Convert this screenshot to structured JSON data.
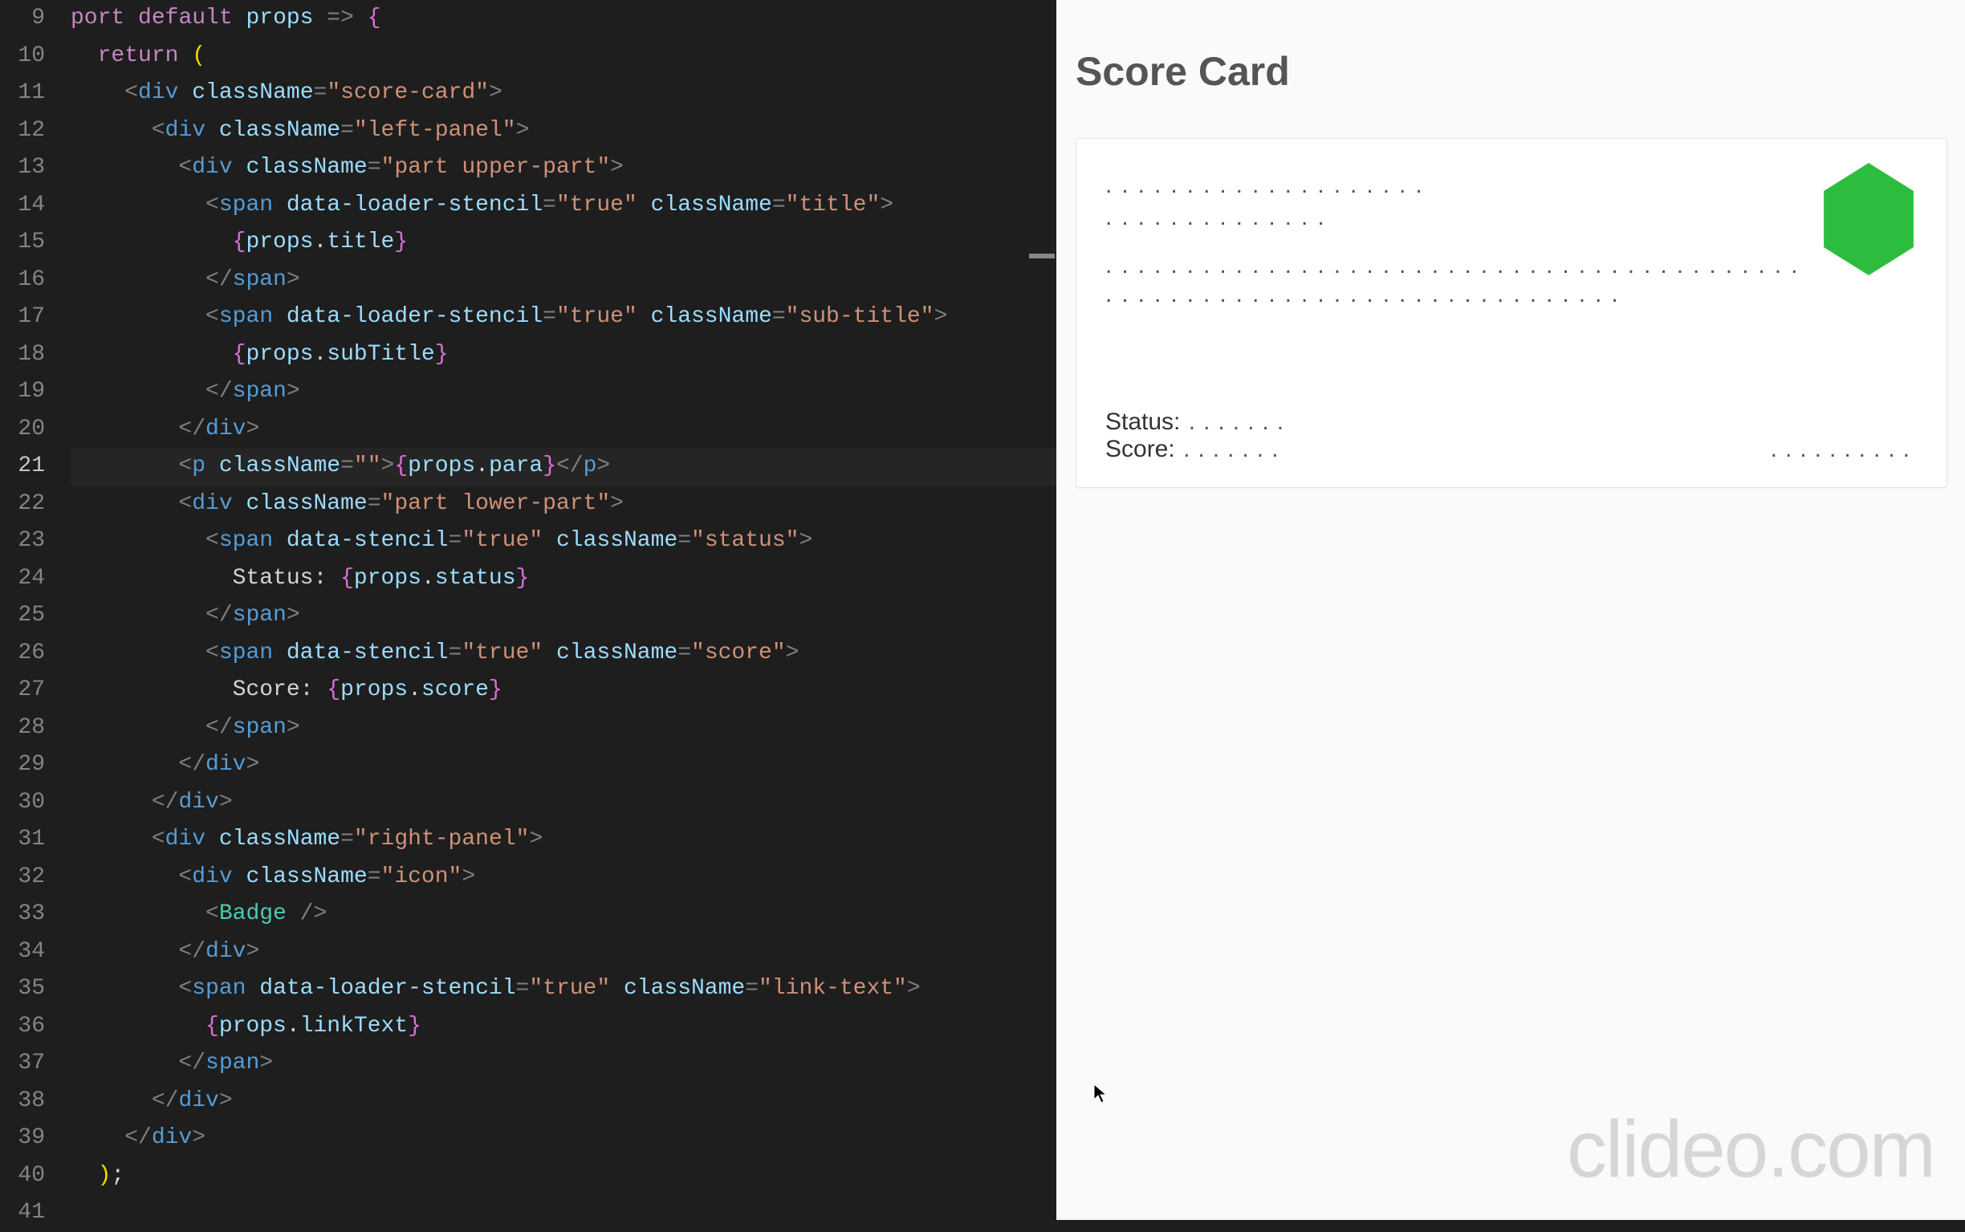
{
  "editor": {
    "first_line_number": 9,
    "current_line": 21,
    "lines": [
      {
        "n": 9,
        "segs": [
          [
            "kw",
            "port"
          ],
          [
            "text-plain",
            " "
          ],
          [
            "kw",
            "default"
          ],
          [
            "text-plain",
            " "
          ],
          [
            "expr-var",
            "props"
          ],
          [
            "text-plain",
            " "
          ],
          [
            "punct",
            "=>"
          ],
          [
            "text-plain",
            " "
          ],
          [
            "brace",
            "{"
          ]
        ]
      },
      {
        "n": 10,
        "segs": [
          [
            "text-plain",
            "  "
          ],
          [
            "kw",
            "return"
          ],
          [
            "text-plain",
            " "
          ],
          [
            "paren",
            "("
          ]
        ]
      },
      {
        "n": 11,
        "segs": [
          [
            "text-plain",
            "    "
          ],
          [
            "punct",
            "<"
          ],
          [
            "tag",
            "div"
          ],
          [
            "text-plain",
            " "
          ],
          [
            "attr",
            "className"
          ],
          [
            "punct",
            "="
          ],
          [
            "str",
            "\"score-card\""
          ],
          [
            "punct",
            ">"
          ]
        ]
      },
      {
        "n": 12,
        "segs": [
          [
            "text-plain",
            "      "
          ],
          [
            "punct",
            "<"
          ],
          [
            "tag",
            "div"
          ],
          [
            "text-plain",
            " "
          ],
          [
            "attr",
            "className"
          ],
          [
            "punct",
            "="
          ],
          [
            "str",
            "\"left-panel\""
          ],
          [
            "punct",
            ">"
          ]
        ]
      },
      {
        "n": 13,
        "segs": [
          [
            "text-plain",
            "        "
          ],
          [
            "punct",
            "<"
          ],
          [
            "tag",
            "div"
          ],
          [
            "text-plain",
            " "
          ],
          [
            "attr",
            "className"
          ],
          [
            "punct",
            "="
          ],
          [
            "str",
            "\"part upper-part\""
          ],
          [
            "punct",
            ">"
          ]
        ]
      },
      {
        "n": 14,
        "segs": [
          [
            "text-plain",
            "          "
          ],
          [
            "punct",
            "<"
          ],
          [
            "tag",
            "span"
          ],
          [
            "text-plain",
            " "
          ],
          [
            "attr",
            "data-loader-stencil"
          ],
          [
            "punct",
            "="
          ],
          [
            "str",
            "\"true\""
          ],
          [
            "text-plain",
            " "
          ],
          [
            "attr",
            "className"
          ],
          [
            "punct",
            "="
          ],
          [
            "str",
            "\"title\""
          ],
          [
            "punct",
            ">"
          ]
        ]
      },
      {
        "n": 15,
        "segs": [
          [
            "text-plain",
            "            "
          ],
          [
            "brace",
            "{"
          ],
          [
            "expr-var",
            "props"
          ],
          [
            "text-plain",
            "."
          ],
          [
            "expr-var",
            "title"
          ],
          [
            "brace",
            "}"
          ]
        ]
      },
      {
        "n": 16,
        "segs": [
          [
            "text-plain",
            "          "
          ],
          [
            "punct",
            "</"
          ],
          [
            "tag",
            "span"
          ],
          [
            "punct",
            ">"
          ]
        ]
      },
      {
        "n": 17,
        "segs": [
          [
            "text-plain",
            "          "
          ],
          [
            "punct",
            "<"
          ],
          [
            "tag",
            "span"
          ],
          [
            "text-plain",
            " "
          ],
          [
            "attr",
            "data-loader-stencil"
          ],
          [
            "punct",
            "="
          ],
          [
            "str",
            "\"true\""
          ],
          [
            "text-plain",
            " "
          ],
          [
            "attr",
            "className"
          ],
          [
            "punct",
            "="
          ],
          [
            "str",
            "\"sub-title\""
          ],
          [
            "punct",
            ">"
          ]
        ]
      },
      {
        "n": 18,
        "segs": [
          [
            "text-plain",
            "            "
          ],
          [
            "brace",
            "{"
          ],
          [
            "expr-var",
            "props"
          ],
          [
            "text-plain",
            "."
          ],
          [
            "expr-var",
            "subTitle"
          ],
          [
            "brace",
            "}"
          ]
        ]
      },
      {
        "n": 19,
        "segs": [
          [
            "text-plain",
            "          "
          ],
          [
            "punct",
            "</"
          ],
          [
            "tag",
            "span"
          ],
          [
            "punct",
            ">"
          ]
        ]
      },
      {
        "n": 20,
        "segs": [
          [
            "text-plain",
            "        "
          ],
          [
            "punct",
            "</"
          ],
          [
            "tag",
            "div"
          ],
          [
            "punct",
            ">"
          ]
        ]
      },
      {
        "n": 21,
        "segs": [
          [
            "text-plain",
            "        "
          ],
          [
            "punct",
            "<"
          ],
          [
            "tag",
            "p"
          ],
          [
            "text-plain",
            " "
          ],
          [
            "attr",
            "className"
          ],
          [
            "punct",
            "="
          ],
          [
            "str",
            "\"\""
          ],
          [
            "punct",
            ">"
          ],
          [
            "brace",
            "{"
          ],
          [
            "expr-var",
            "props"
          ],
          [
            "text-plain",
            "."
          ],
          [
            "expr-var",
            "para"
          ],
          [
            "brace",
            "}"
          ],
          [
            "punct",
            "</"
          ],
          [
            "tag",
            "p"
          ],
          [
            "punct",
            ">"
          ]
        ]
      },
      {
        "n": 22,
        "segs": [
          [
            "text-plain",
            "        "
          ],
          [
            "punct",
            "<"
          ],
          [
            "tag",
            "div"
          ],
          [
            "text-plain",
            " "
          ],
          [
            "attr",
            "className"
          ],
          [
            "punct",
            "="
          ],
          [
            "str",
            "\"part lower-part\""
          ],
          [
            "punct",
            ">"
          ]
        ]
      },
      {
        "n": 23,
        "segs": [
          [
            "text-plain",
            "          "
          ],
          [
            "punct",
            "<"
          ],
          [
            "tag",
            "span"
          ],
          [
            "text-plain",
            " "
          ],
          [
            "attr",
            "data-stencil"
          ],
          [
            "punct",
            "="
          ],
          [
            "str",
            "\"true\""
          ],
          [
            "text-plain",
            " "
          ],
          [
            "attr",
            "className"
          ],
          [
            "punct",
            "="
          ],
          [
            "str",
            "\"status\""
          ],
          [
            "punct",
            ">"
          ]
        ]
      },
      {
        "n": 24,
        "segs": [
          [
            "text-plain",
            "            Status: "
          ],
          [
            "brace",
            "{"
          ],
          [
            "expr-var",
            "props"
          ],
          [
            "text-plain",
            "."
          ],
          [
            "expr-var",
            "status"
          ],
          [
            "brace",
            "}"
          ]
        ]
      },
      {
        "n": 25,
        "segs": [
          [
            "text-plain",
            "          "
          ],
          [
            "punct",
            "</"
          ],
          [
            "tag",
            "span"
          ],
          [
            "punct",
            ">"
          ]
        ]
      },
      {
        "n": 26,
        "segs": [
          [
            "text-plain",
            "          "
          ],
          [
            "punct",
            "<"
          ],
          [
            "tag",
            "span"
          ],
          [
            "text-plain",
            " "
          ],
          [
            "attr",
            "data-stencil"
          ],
          [
            "punct",
            "="
          ],
          [
            "str",
            "\"true\""
          ],
          [
            "text-plain",
            " "
          ],
          [
            "attr",
            "className"
          ],
          [
            "punct",
            "="
          ],
          [
            "str",
            "\"score\""
          ],
          [
            "punct",
            ">"
          ]
        ]
      },
      {
        "n": 27,
        "segs": [
          [
            "text-plain",
            "            Score: "
          ],
          [
            "brace",
            "{"
          ],
          [
            "expr-var",
            "props"
          ],
          [
            "text-plain",
            "."
          ],
          [
            "expr-var",
            "score"
          ],
          [
            "brace",
            "}"
          ]
        ]
      },
      {
        "n": 28,
        "segs": [
          [
            "text-plain",
            "          "
          ],
          [
            "punct",
            "</"
          ],
          [
            "tag",
            "span"
          ],
          [
            "punct",
            ">"
          ]
        ]
      },
      {
        "n": 29,
        "segs": [
          [
            "text-plain",
            "        "
          ],
          [
            "punct",
            "</"
          ],
          [
            "tag",
            "div"
          ],
          [
            "punct",
            ">"
          ]
        ]
      },
      {
        "n": 30,
        "segs": [
          [
            "text-plain",
            "      "
          ],
          [
            "punct",
            "</"
          ],
          [
            "tag",
            "div"
          ],
          [
            "punct",
            ">"
          ]
        ]
      },
      {
        "n": 31,
        "segs": [
          [
            "text-plain",
            "      "
          ],
          [
            "punct",
            "<"
          ],
          [
            "tag",
            "div"
          ],
          [
            "text-plain",
            " "
          ],
          [
            "attr",
            "className"
          ],
          [
            "punct",
            "="
          ],
          [
            "str",
            "\"right-panel\""
          ],
          [
            "punct",
            ">"
          ]
        ]
      },
      {
        "n": 32,
        "segs": [
          [
            "text-plain",
            "        "
          ],
          [
            "punct",
            "<"
          ],
          [
            "tag",
            "div"
          ],
          [
            "text-plain",
            " "
          ],
          [
            "attr",
            "className"
          ],
          [
            "punct",
            "="
          ],
          [
            "str",
            "\"icon\""
          ],
          [
            "punct",
            ">"
          ]
        ]
      },
      {
        "n": 33,
        "segs": [
          [
            "text-plain",
            "          "
          ],
          [
            "punct",
            "<"
          ],
          [
            "tag-name",
            "Badge"
          ],
          [
            "text-plain",
            " "
          ],
          [
            "punct",
            "/>"
          ]
        ]
      },
      {
        "n": 34,
        "segs": [
          [
            "text-plain",
            "        "
          ],
          [
            "punct",
            "</"
          ],
          [
            "tag",
            "div"
          ],
          [
            "punct",
            ">"
          ]
        ]
      },
      {
        "n": 35,
        "segs": [
          [
            "text-plain",
            "        "
          ],
          [
            "punct",
            "<"
          ],
          [
            "tag",
            "span"
          ],
          [
            "text-plain",
            " "
          ],
          [
            "attr",
            "data-loader-stencil"
          ],
          [
            "punct",
            "="
          ],
          [
            "str",
            "\"true\""
          ],
          [
            "text-plain",
            " "
          ],
          [
            "attr",
            "className"
          ],
          [
            "punct",
            "="
          ],
          [
            "str",
            "\"link-text\""
          ],
          [
            "punct",
            ">"
          ]
        ]
      },
      {
        "n": 36,
        "segs": [
          [
            "text-plain",
            "          "
          ],
          [
            "brace",
            "{"
          ],
          [
            "expr-var",
            "props"
          ],
          [
            "text-plain",
            "."
          ],
          [
            "expr-var",
            "linkText"
          ],
          [
            "brace",
            "}"
          ]
        ]
      },
      {
        "n": 37,
        "segs": [
          [
            "text-plain",
            "        "
          ],
          [
            "punct",
            "</"
          ],
          [
            "tag",
            "span"
          ],
          [
            "punct",
            ">"
          ]
        ]
      },
      {
        "n": 38,
        "segs": [
          [
            "text-plain",
            "      "
          ],
          [
            "punct",
            "</"
          ],
          [
            "tag",
            "div"
          ],
          [
            "punct",
            ">"
          ]
        ]
      },
      {
        "n": 39,
        "segs": [
          [
            "text-plain",
            "    "
          ],
          [
            "punct",
            "</"
          ],
          [
            "tag",
            "div"
          ],
          [
            "punct",
            ">"
          ]
        ]
      },
      {
        "n": 40,
        "segs": [
          [
            "text-plain",
            "  "
          ],
          [
            "paren",
            ")"
          ],
          [
            "text-plain",
            ";"
          ]
        ]
      },
      {
        "n": 41,
        "segs": [
          [
            "text-plain",
            " "
          ]
        ]
      }
    ]
  },
  "preview": {
    "heading": "Score Card",
    "title_stencil": "....................",
    "subtitle_stencil": "..............",
    "para_stencil": "...........................................................................",
    "status_label": "Status:",
    "status_stencil": ".......",
    "score_label": "Score:",
    "score_stencil": ".......",
    "link_stencil": ".........."
  },
  "watermark": "clideo.com"
}
